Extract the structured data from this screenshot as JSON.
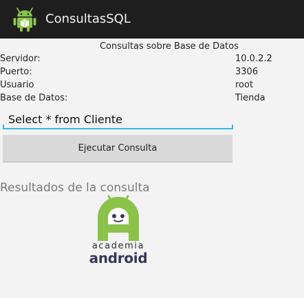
{
  "app": {
    "title": "ConsultasSQL",
    "icon": "android-app-icon"
  },
  "form": {
    "heading": "Consultas sobre Base de Datos",
    "fields": [
      {
        "label": "Servidor:",
        "value": "10.0.2.2"
      },
      {
        "label": "Puerto:",
        "value": "3306"
      },
      {
        "label": "Usuario",
        "value": "root"
      },
      {
        "label": "Base de Datos:",
        "value": "Tienda"
      }
    ],
    "query": {
      "value": "Select * from Cliente"
    },
    "execute_label": "Ejecutar Consulta"
  },
  "results": {
    "title": "Resultados de la consulta",
    "logo_line1": "academia",
    "logo_line2": "android"
  },
  "colors": {
    "action_bar": "#1e1e1e",
    "accent": "#33b5e5",
    "android_green": "#8bc34a",
    "logo_text": "#37375a"
  }
}
